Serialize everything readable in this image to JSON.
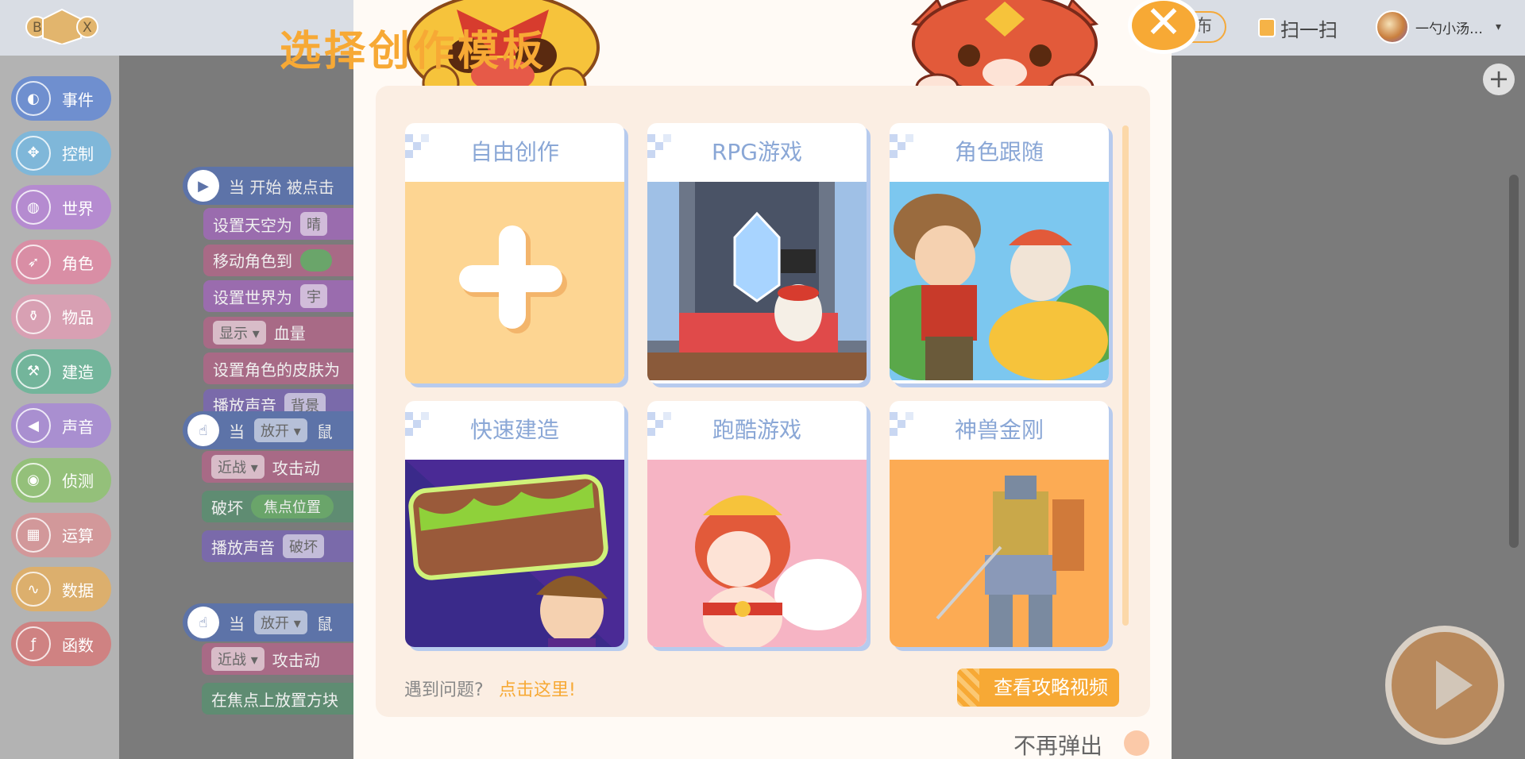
{
  "topbar": {
    "logo_text": "BOX",
    "publish_label": "布",
    "scan_label": "扫一扫",
    "user_name": "一勺小汤…",
    "caret": "▾"
  },
  "sidebar": {
    "items": [
      {
        "label": "事件",
        "icon": "toggle-icon",
        "glyph": "◐",
        "color": "#6f8fcf",
        "name": "sidebar-item-events"
      },
      {
        "label": "控制",
        "icon": "gamepad-icon",
        "glyph": "✥",
        "color": "#7fb7d9",
        "name": "sidebar-item-control"
      },
      {
        "label": "世界",
        "icon": "globe-icon",
        "glyph": "◍",
        "color": "#b58bd0",
        "name": "sidebar-item-world"
      },
      {
        "label": "角色",
        "icon": "runner-icon",
        "glyph": "➶",
        "color": "#d98ea5",
        "name": "sidebar-item-character"
      },
      {
        "label": "物品",
        "icon": "potion-icon",
        "glyph": "⚱",
        "color": "#d8a0b3",
        "name": "sidebar-item-items"
      },
      {
        "label": "建造",
        "icon": "wrench-icon",
        "glyph": "⚒",
        "color": "#73b59b",
        "name": "sidebar-item-build"
      },
      {
        "label": "声音",
        "icon": "speaker-icon",
        "glyph": "◀",
        "color": "#a98fd0",
        "name": "sidebar-item-sound"
      },
      {
        "label": "侦测",
        "icon": "radar-icon",
        "glyph": "◉",
        "color": "#94c07a",
        "name": "sidebar-item-sensing"
      },
      {
        "label": "运算",
        "icon": "grid-icon",
        "glyph": "▦",
        "color": "#d2989a",
        "name": "sidebar-item-operators"
      },
      {
        "label": "数据",
        "icon": "chart-icon",
        "glyph": "∿",
        "color": "#dcaf6d",
        "name": "sidebar-item-data"
      },
      {
        "label": "函数",
        "icon": "function-icon",
        "glyph": "ƒ",
        "color": "#cf8282",
        "name": "sidebar-item-functions"
      }
    ]
  },
  "workspace": {
    "script1": {
      "hat": "当 开始 被点击",
      "lines": [
        {
          "text": "设置天空为",
          "pill": "晴",
          "color": "#9a6cae"
        },
        {
          "text": "移动角色到",
          "gpill": "",
          "color": "#a86a86"
        },
        {
          "text": "设置世界为",
          "pill": "宇",
          "color": "#9a6cae"
        },
        {
          "pill_first": "显示 ▾",
          "text": "血量",
          "color": "#a86a86"
        },
        {
          "text": "设置角色的皮肤为",
          "color": "#a86a86"
        },
        {
          "text": "播放声音",
          "pill": "背景",
          "color": "#7a6aaa"
        }
      ]
    },
    "script2": {
      "hat_label": "当",
      "hat_pill": "放开 ▾",
      "hat_tail": "鼠",
      "lines": [
        {
          "pill_first": "近战 ▾",
          "text": "攻击动",
          "color": "#a86a86"
        },
        {
          "text": "破坏",
          "gpill": "焦点位置",
          "color": "#5f8c72"
        },
        {
          "text": "播放声音",
          "pill": "破坏",
          "color": "#7a6aaa"
        }
      ]
    },
    "script3": {
      "hat_label": "当",
      "hat_pill": "放开 ▾",
      "hat_tail": "鼠",
      "lines": [
        {
          "pill_first": "近战 ▾",
          "text": "攻击动",
          "color": "#a86a86"
        },
        {
          "text": "在焦点上放置方块",
          "color": "#5f8c72"
        }
      ]
    }
  },
  "modal": {
    "title": "选择创作模板",
    "close_glyph": "✕",
    "templates": [
      {
        "title": "自由创作",
        "kind": "free"
      },
      {
        "title": "RPG游戏",
        "kind": "rpg"
      },
      {
        "title": "角色跟随",
        "kind": "follow"
      },
      {
        "title": "快速建造",
        "kind": "build"
      },
      {
        "title": "跑酷游戏",
        "kind": "parkour"
      },
      {
        "title": "神兽金刚",
        "kind": "mecha"
      }
    ],
    "help_text": "遇到问题?",
    "help_link": "点击这里!",
    "video_button": "查看攻略视频",
    "dont_show_label": "不再弹出"
  },
  "colors": {
    "accent": "#f7a935",
    "card_title": "#8aa7d6",
    "panel_bg": "#fbeee3"
  }
}
